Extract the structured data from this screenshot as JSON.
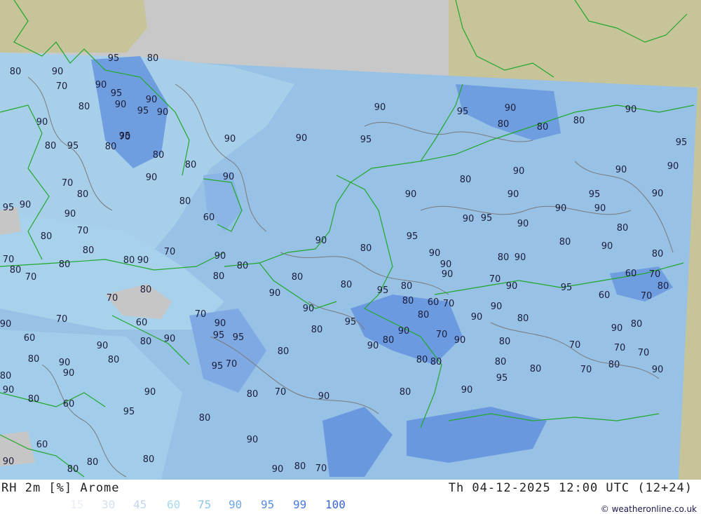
{
  "title": {
    "parameter": "RH 2m [%] Arome",
    "valid_time": "Th 04-12-2025 12:00 UTC (12+24)"
  },
  "legend": {
    "items": [
      {
        "value": "15",
        "color": "#e8eef8"
      },
      {
        "value": "30",
        "color": "#d4e0f0"
      },
      {
        "value": "45",
        "color": "#c4d4ec"
      },
      {
        "value": "60",
        "color": "#a8d8ee"
      },
      {
        "value": "75",
        "color": "#8ec6ea"
      },
      {
        "value": "90",
        "color": "#6ea6e4"
      },
      {
        "value": "95",
        "color": "#5a8ee2"
      },
      {
        "value": "99",
        "color": "#4a78dc"
      },
      {
        "value": "100",
        "color": "#3a62d4"
      }
    ]
  },
  "credit": "© weatheronline.co.uk",
  "contour_labels": [
    "95",
    "80",
    "80",
    "90",
    "70",
    "90",
    "95",
    "90",
    "80",
    "90",
    "95",
    "90",
    "90",
    "70",
    "80",
    "95",
    "80",
    "80",
    "80",
    "90",
    "90",
    "70",
    "80",
    "95",
    "90",
    "90",
    "80",
    "60",
    "70",
    "80",
    "80",
    "70",
    "90",
    "80",
    "90",
    "70",
    "80",
    "80",
    "70",
    "80",
    "80",
    "80",
    "70",
    "90",
    "70",
    "60",
    "60",
    "70",
    "90",
    "90",
    "80",
    "95",
    "95",
    "90",
    "95",
    "70",
    "80",
    "90",
    "80",
    "90",
    "80",
    "90",
    "80",
    "60",
    "95",
    "90",
    "80",
    "70",
    "80",
    "90",
    "60",
    "80",
    "80",
    "90",
    "80",
    "90",
    "80",
    "70",
    "90",
    "90",
    "90",
    "95",
    "95",
    "90",
    "80",
    "80",
    "80",
    "90",
    "95",
    "95",
    "90",
    "90",
    "90",
    "80",
    "90",
    "90",
    "95",
    "90",
    "90",
    "90",
    "90",
    "95",
    "90",
    "80",
    "95",
    "80",
    "90",
    "90",
    "80",
    "90",
    "80",
    "90",
    "80",
    "90",
    "90",
    "80",
    "70",
    "60",
    "70",
    "80",
    "80",
    "95",
    "90",
    "95",
    "80",
    "90",
    "60",
    "70",
    "80",
    "60",
    "70",
    "90",
    "90",
    "95",
    "80",
    "90",
    "80",
    "80",
    "90",
    "80",
    "90",
    "80",
    "70",
    "90",
    "90",
    "80",
    "70",
    "70",
    "70",
    "80",
    "80",
    "80",
    "80",
    "80",
    "70",
    "80",
    "90",
    "95",
    "90",
    "80",
    "90"
  ],
  "colors": {
    "land_outside": "#c7c49a",
    "no_data": "#c8c8c8",
    "sea": "#a6cbe8",
    "borders": "#1fa82a",
    "contours": "#7a7a7a"
  }
}
